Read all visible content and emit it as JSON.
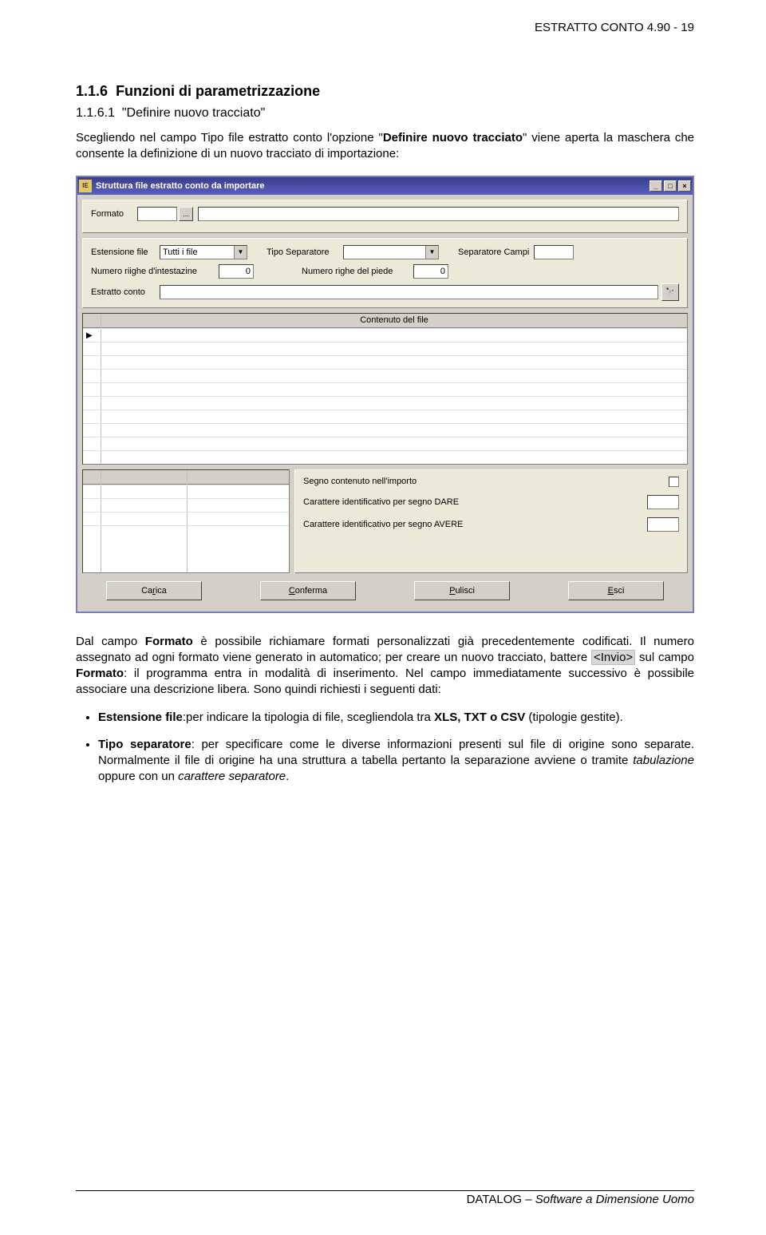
{
  "header": {
    "right": "ESTRATTO CONTO 4.90 - 19"
  },
  "section": {
    "num": "1.1.6",
    "title_rest": "Funzioni di parametrizzazione",
    "sub_num": "1.1.6.1",
    "sub_rest": "Definire nuovo tracciato"
  },
  "para1_a": "Scegliendo nel campo Tipo file estratto conto l'opzione ",
  "para1_b": "Definire nuovo tracciato",
  "para1_c": " viene aperta la maschera che consente la definizione di un nuovo tracciato di importazione:",
  "win": {
    "title": "Struttura file estratto conto da importare",
    "labels": {
      "formato": "Formato",
      "ellipsis": "...",
      "estensione": "Estensione file",
      "tipo_sep": "Tipo Separatore",
      "sep_campi": "Separatore Campi",
      "n_intest": "Numero riighe d'intestazine",
      "n_piede": "Numero righe del piede",
      "estratto": "Estratto conto",
      "contenuto": "Contenuto del file",
      "segno": "Segno contenuto nell'importo",
      "dare": "Carattere identificativo per segno DARE",
      "avere": "Carattere identificativo per segno AVERE"
    },
    "values": {
      "estensione": "Tutti i file",
      "n_intest": "0",
      "n_piede": "0"
    },
    "buttons": {
      "carica": "Carica",
      "conferma": "Conferma",
      "pulisci": "Pulisci",
      "esci": "Esci"
    },
    "winctrl": {
      "min": "_",
      "max": "□",
      "close": "×"
    }
  },
  "para2_a": "Dal campo ",
  "para2_b": "Formato",
  "para2_c": " è possibile richiamare formati personalizzati già precedentemente codificati. Il numero assegnato ad ogni formato viene generato in automatico; per creare un nuovo tracciato, battere ",
  "para2_key": "<Invio>",
  "para2_d": " sul campo ",
  "para2_e": "Formato",
  "para2_f": ": il programma entra in modalità di inserimento. Nel campo immediatamente successivo è possibile associare una descrizione libera. Sono quindi  richiesti i seguenti dati:",
  "bul1_a": "Estensione file",
  "bul1_b": ":per indicare la tipologia di file, scegliendola tra ",
  "bul1_c": "XLS, TXT o CSV",
  "bul1_d": " (tipologie gestite).",
  "bul2_a": "Tipo separatore",
  "bul2_b": ": per specificare come le diverse informazioni presenti sul file di origine sono separate. Normalmente il file di origine ha una struttura a tabella pertanto la separazione avviene o tramite ",
  "bul2_c": "tabulazione",
  "bul2_d": " oppure con un ",
  "bul2_e": "carattere separatore",
  "bul2_f": ".",
  "footer": {
    "brand": "DATALOG",
    "rest": " – Software a Dimensione Uomo"
  }
}
